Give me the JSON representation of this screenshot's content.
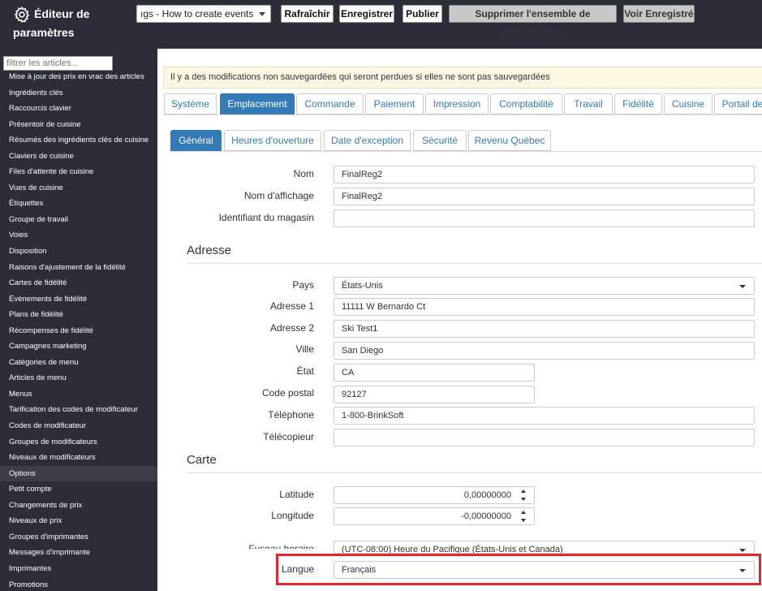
{
  "header": {
    "title_line1": "Éditeur de",
    "title_line2": "paramètres",
    "changeset_value": "ıgs - How to create events",
    "buttons": {
      "refresh": "Rafraîchir",
      "save": "Enregistrer",
      "publish": "Publier",
      "delete_changeset": "Supprimer l'ensemble de modifications",
      "view_saved": "Voir Enregistré"
    }
  },
  "sidebar": {
    "filter_placeholder": "filtrer les articles...",
    "items": [
      "Mise à jour des prix en vrac des articles",
      "Ingrédients clés",
      "Raccourcis clavier",
      "Présentoir de cuisine",
      "Résumés des ingrédients clés de cuisine",
      "Claviers de cuisine",
      "Files d'attente de cuisine",
      "Vues de cuisine",
      "Étiquettes",
      "Groupe de travail",
      "Voies",
      "Disposition",
      "Raisons d'ajustement de la fidélité",
      "Cartes de fidélité",
      "Événements de fidélité",
      "Plans de fidélité",
      "Récompenses de fidélité",
      "Campagnes marketing",
      "Catégories de menu",
      "Articles de menu",
      "Menus",
      "Tarification des codes de modificateur",
      "Codes de modificateur",
      "Groupes de modificateurs",
      "Niveaux de modificateurs",
      "Options",
      "Petit compte",
      "Changements de prix",
      "Niveaux de prix",
      "Groupes d'imprimantes",
      "Messages d'imprimante",
      "Imprimantes",
      "Promotions"
    ]
  },
  "alert": "Il y a des modifications non sauvegardées qui seront perdues si elles ne sont pas sauvegardées",
  "tabs": [
    "Système",
    "Emplacement",
    "Commande",
    "Paiement",
    "Impression",
    "Comptabilité",
    "Travail",
    "Fidélité",
    "Cuisine",
    "Portail de"
  ],
  "subtabs": [
    "Général",
    "Heures d'ouverture",
    "Date d'exception",
    "Sécurité",
    "Revenu Québec"
  ],
  "form": {
    "nom": {
      "label": "Nom",
      "value": "FinalReg2"
    },
    "nom_affichage": {
      "label": "Nom d'affichage",
      "value": "FinalReg2"
    },
    "identifiant": {
      "label": "Identifiant du magasin",
      "value": ""
    },
    "adresse_section": "Adresse",
    "pays": {
      "label": "Pays",
      "value": "États-Unis"
    },
    "adresse1": {
      "label": "Adresse 1",
      "value": "11111 W Bernardo Ct"
    },
    "adresse2": {
      "label": "Adresse 2",
      "value": "Ski Test1"
    },
    "ville": {
      "label": "Ville",
      "value": "San Diego"
    },
    "etat": {
      "label": "État",
      "value": "CA"
    },
    "code_postal": {
      "label": "Code postal",
      "value": "92127"
    },
    "telephone": {
      "label": "Téléphone",
      "value": "1-800-BrinkSoft"
    },
    "telecopieur": {
      "label": "Télécopieur",
      "value": ""
    },
    "carte_section": "Carte",
    "latitude": {
      "label": "Latitude",
      "value": "0,00000000"
    },
    "longitude": {
      "label": "Longitude",
      "value": "-0,00000000"
    },
    "fuseau": {
      "label": "Fuseau horaire",
      "value": "(UTC-08:00) Heure du Pacifique (États-Unis et Canada)"
    },
    "langue": {
      "label": "Langue",
      "value": "Français"
    }
  },
  "colors": {
    "dark": "#2b2e37",
    "accent": "#337ab7",
    "highlight": "#e8262a"
  }
}
